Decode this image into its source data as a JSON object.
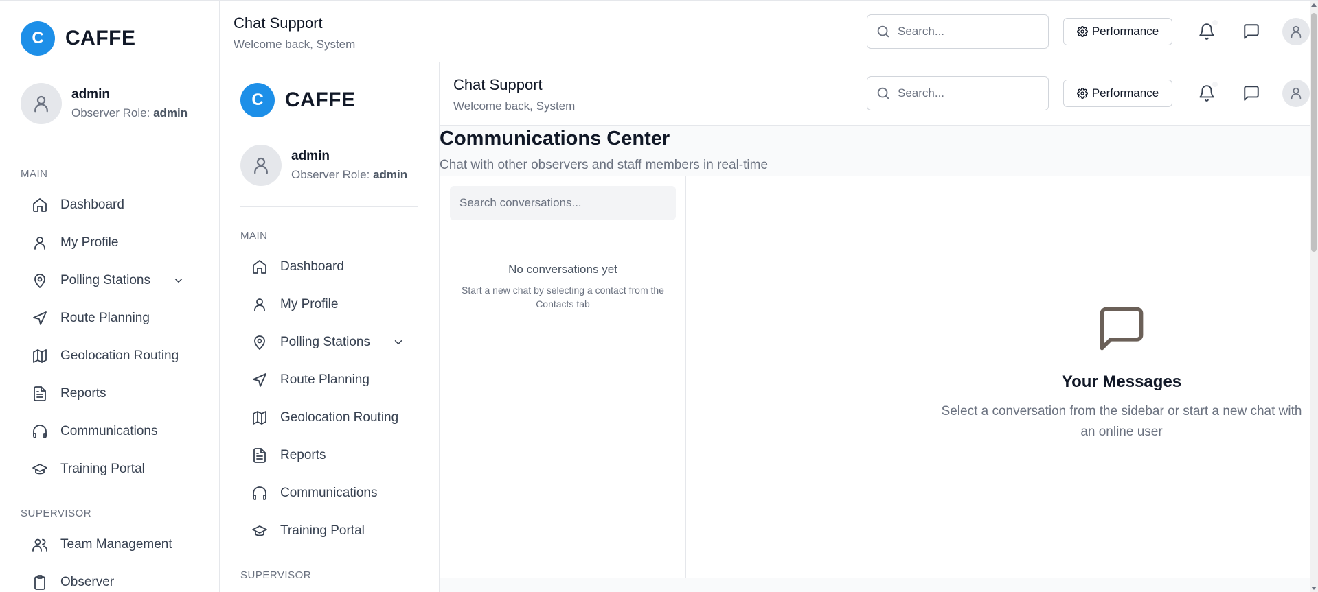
{
  "brand": {
    "initial": "C",
    "name": "CAFFE",
    "color": "#1d8fe8"
  },
  "user": {
    "name": "admin",
    "role_prefix": "Observer Role:",
    "role": "admin"
  },
  "sidebar": {
    "main_label": "MAIN",
    "supervisor_label": "SUPERVISOR",
    "items": [
      {
        "label": "Dashboard",
        "icon": "home-icon"
      },
      {
        "label": "My Profile",
        "icon": "user-icon"
      },
      {
        "label": "Polling Stations",
        "icon": "map-pin-icon",
        "expandable": true
      },
      {
        "label": "Route Planning",
        "icon": "navigation-icon"
      },
      {
        "label": "Geolocation Routing",
        "icon": "map-icon"
      },
      {
        "label": "Reports",
        "icon": "file-text-icon"
      },
      {
        "label": "Communications",
        "icon": "headphones-icon"
      },
      {
        "label": "Training Portal",
        "icon": "graduation-cap-icon"
      }
    ],
    "supervisor_items": [
      {
        "label": "Team Management",
        "icon": "users-icon"
      },
      {
        "label": "Observer",
        "icon": "clipboard-icon"
      }
    ]
  },
  "header": {
    "title": "Chat Support",
    "subtitle": "Welcome back, System",
    "search_placeholder": "Search...",
    "performance_label": "Performance"
  },
  "page": {
    "title": "Communications Center",
    "subtitle": "Chat with other observers and staff members in real-time"
  },
  "conversations": {
    "search_placeholder": "Search conversations...",
    "empty_title": "No conversations yet",
    "empty_subtitle": "Start a new chat by selecting a contact from the Contacts tab"
  },
  "chat": {
    "empty_title": "Your Messages",
    "empty_subtitle": "Select a conversation from the sidebar or start a new chat with an online user"
  }
}
